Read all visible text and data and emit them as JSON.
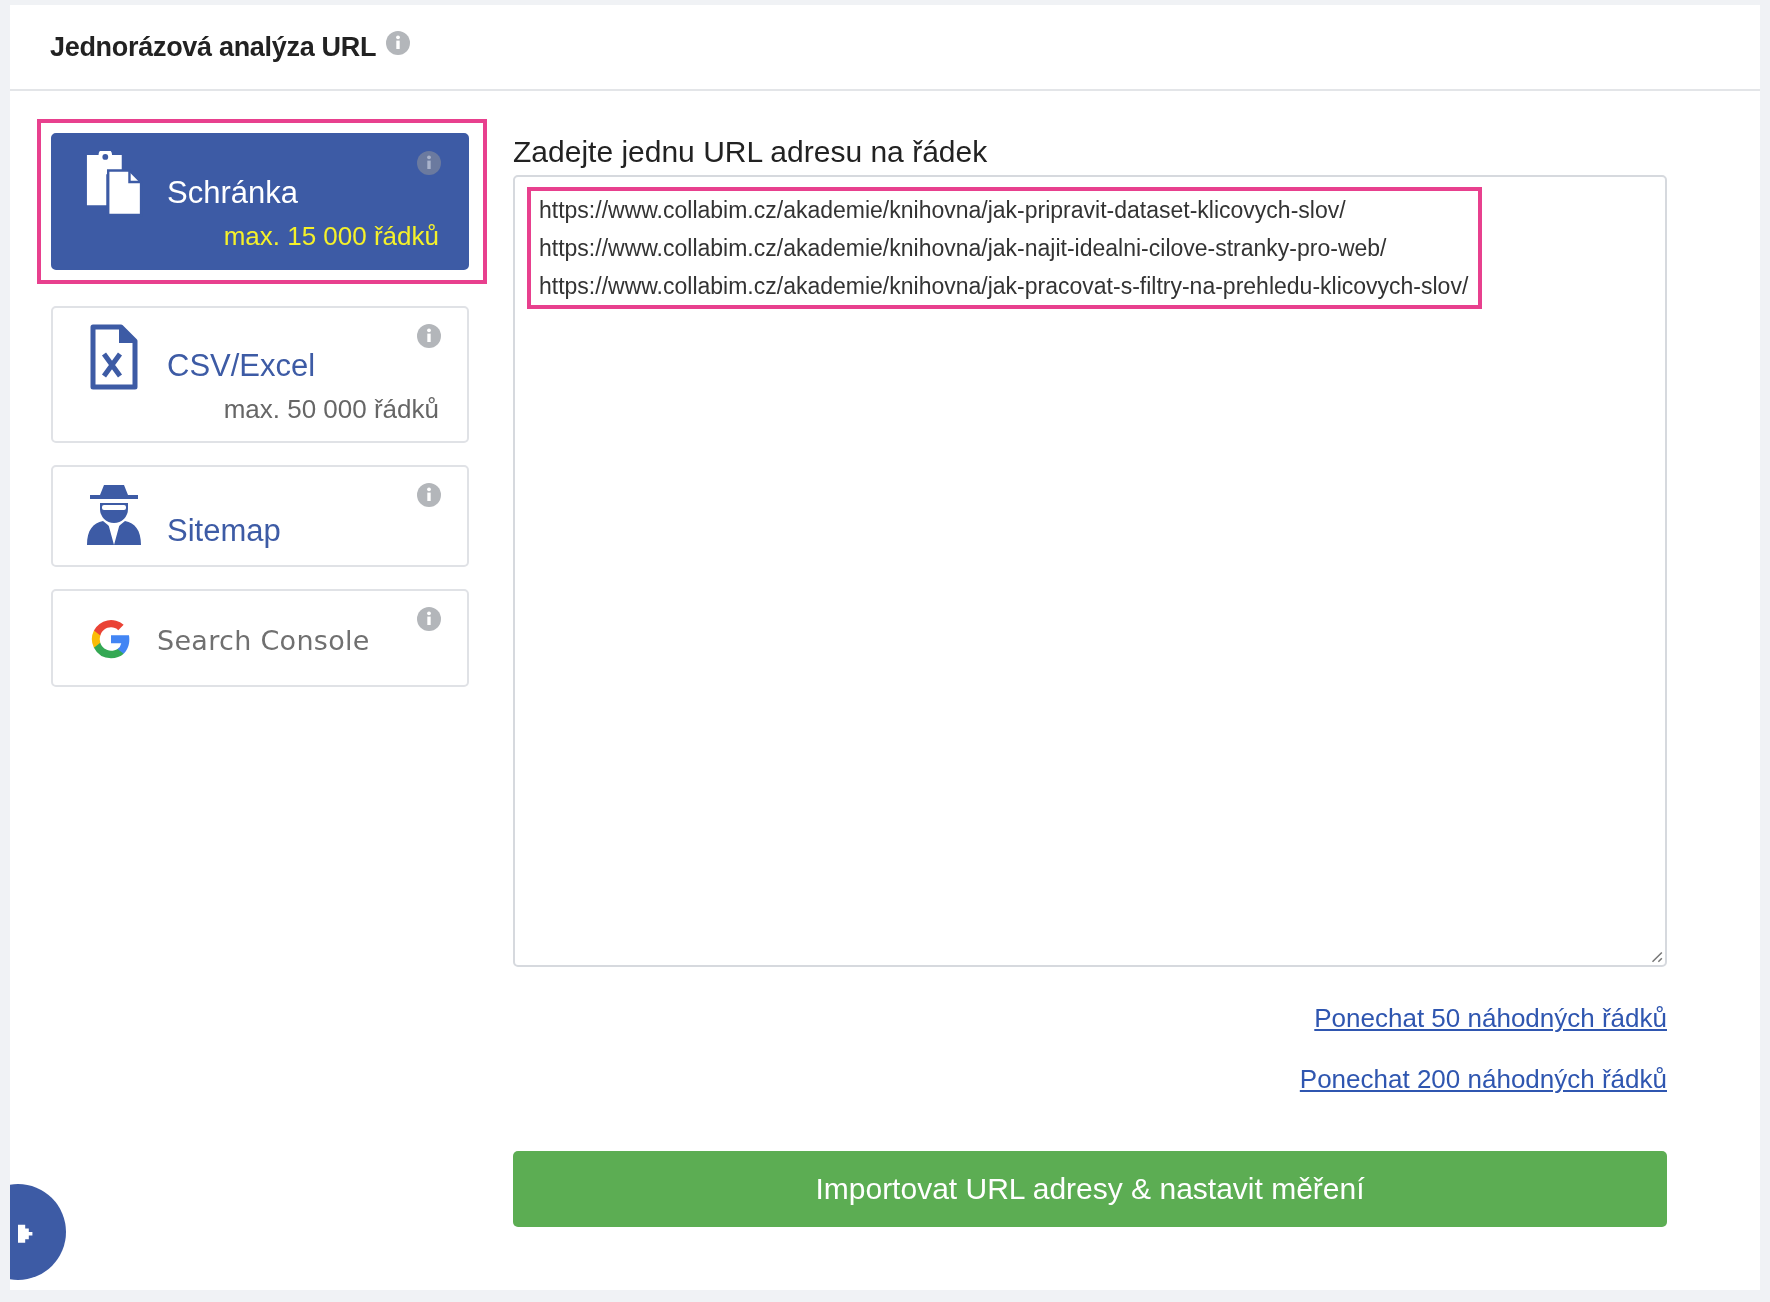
{
  "header": {
    "title": "Jednorázová analýza URL"
  },
  "sources": [
    {
      "kind": "clipboard",
      "label": "Schránka",
      "note": "max. 15 000 řádků",
      "selected": true,
      "highlighted": true
    },
    {
      "kind": "csv",
      "label": "CSV/Excel",
      "note": "max. 50 000 řádků",
      "selected": false,
      "highlighted": false
    },
    {
      "kind": "sitemap",
      "label": "Sitemap",
      "selected": false,
      "highlighted": false
    },
    {
      "kind": "search-console",
      "label": "Search Console",
      "selected": false,
      "highlighted": false
    }
  ],
  "input": {
    "label": "Zadejte jednu URL adresu na řádek",
    "lines": [
      "https://www.collabim.cz/akademie/knihovna/jak-pripravit-dataset-klicovych-slov/",
      "https://www.collabim.cz/akademie/knihovna/jak-najit-idealni-cilove-stranky-pro-web/",
      "https://www.collabim.cz/akademie/knihovna/jak-pracovat-s-filtry-na-prehledu-klicovych-slov/"
    ],
    "highlighted": true
  },
  "links": [
    "Ponechat 50 náhodných řádků",
    "Ponechat 200 náhodných řádků"
  ],
  "submit": "Importovat URL adresy & nastavit měření"
}
